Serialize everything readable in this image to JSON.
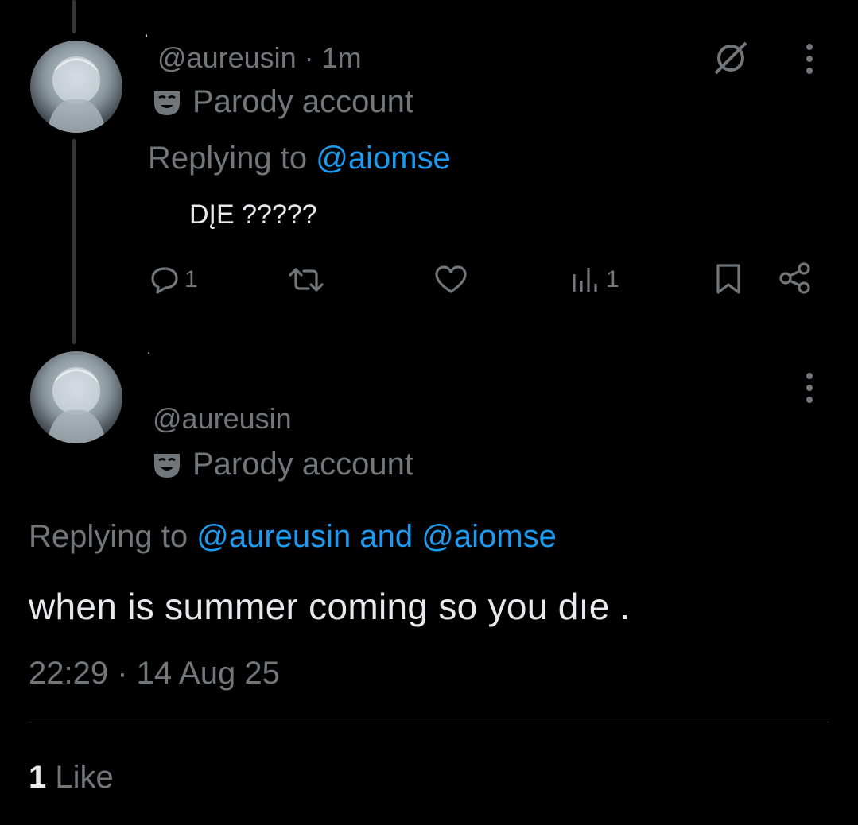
{
  "first_tweet": {
    "display_name": "'",
    "handle": "@aureusin",
    "time": "· 1m",
    "badge": "Parody account",
    "replying_prefix": "Replying to",
    "replying_to": "@aiomse",
    "text": "DĮE ?????",
    "replies": "1",
    "views": "1",
    "icons": [
      "avatar-image",
      "grok-slash-icon",
      "more-icon",
      "mask-icon",
      "reply-icon",
      "retweet-icon",
      "like-icon",
      "views-icon",
      "bookmark-icon",
      "share-icon"
    ]
  },
  "main_tweet": {
    "display_name": ".",
    "handle": "@aureusin",
    "badge": "Parody account",
    "replying_prefix": "Replying to",
    "replying_to": "@aureusin and @aiomse",
    "text": "when is summer coming so you dıe .",
    "timestamp": "22:29 · 14 Aug 25",
    "like_count": "1",
    "like_label": "Like"
  },
  "colors": {
    "background": "#000000",
    "text": "#e7e9ea",
    "muted": "#71767b",
    "link": "#1d9bf0",
    "divider": "#2f3336"
  }
}
